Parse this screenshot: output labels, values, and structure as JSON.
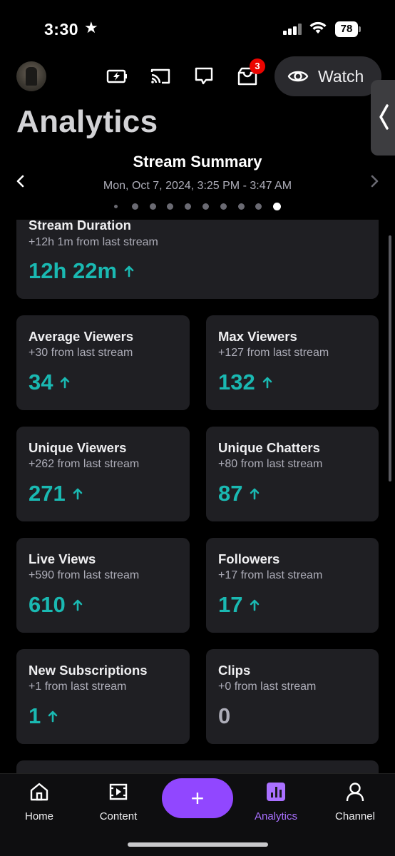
{
  "status_bar": {
    "time": "3:30",
    "battery": "78"
  },
  "header": {
    "notification_count": "3",
    "watch_label": "Watch",
    "page_title": "Analytics"
  },
  "summary": {
    "title": "Stream Summary",
    "date_range": "Mon, Oct 7, 2024, 3:25 PM - 3:47 AM",
    "page_count": 10,
    "active_page": 10
  },
  "stats": {
    "duration": {
      "title": "Stream Duration",
      "delta": "+12h 1m from last stream",
      "value": "12h 22m",
      "trend": "up"
    },
    "avg_viewers": {
      "title": "Average Viewers",
      "delta": "+30 from last stream",
      "value": "34",
      "trend": "up"
    },
    "max_viewers": {
      "title": "Max Viewers",
      "delta": "+127 from last stream",
      "value": "132",
      "trend": "up"
    },
    "unique_viewers": {
      "title": "Unique Viewers",
      "delta": "+262 from last stream",
      "value": "271",
      "trend": "up"
    },
    "unique_chatters": {
      "title": "Unique Chatters",
      "delta": "+80 from last stream",
      "value": "87",
      "trend": "up"
    },
    "live_views": {
      "title": "Live Views",
      "delta": "+590 from last stream",
      "value": "610",
      "trend": "up"
    },
    "followers": {
      "title": "Followers",
      "delta": "+17 from last stream",
      "value": "17",
      "trend": "up"
    },
    "new_subs": {
      "title": "New Subscriptions",
      "delta": "+1 from last stream",
      "value": "1",
      "trend": "up"
    },
    "clips": {
      "title": "Clips",
      "delta": "+0 from last stream",
      "value": "0",
      "trend": "none"
    }
  },
  "nav": {
    "home": "Home",
    "content": "Content",
    "create": "+",
    "analytics": "Analytics",
    "channel": "Channel"
  },
  "colors": {
    "accent": "#9147ff",
    "positive": "#1ab9b2",
    "card_bg": "#1f1f23",
    "badge": "#eb0400"
  }
}
